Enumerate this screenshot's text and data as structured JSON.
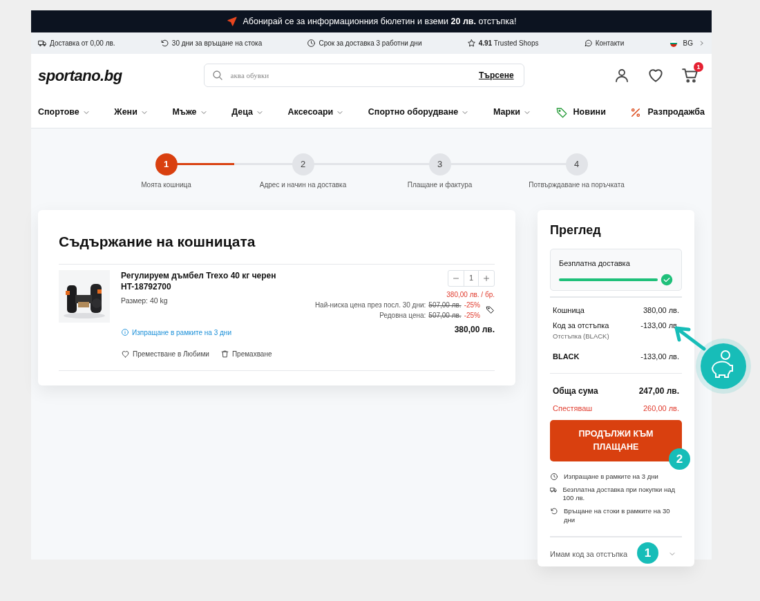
{
  "promo_bar": {
    "text": "Абонирай се за информационния бюлетин и вземи **20 лв.** отстъпка!"
  },
  "info_bar": [
    {
      "kind": "truck",
      "text": "Доставка от 0,00 лв."
    },
    {
      "kind": "return",
      "text": "30 дни за връщане на стока"
    },
    {
      "kind": "clock",
      "text": "Срок за доставка 3 работни дни"
    },
    {
      "kind": "star",
      "text": "**4.91** Trusted Shops"
    },
    {
      "kind": "chat",
      "text": "Контакти"
    },
    {
      "kind": "flag",
      "text": "BG"
    }
  ],
  "header": {
    "logo": "sportano.bg",
    "search": {
      "placeholder": "аква обувки",
      "button": "Търсене"
    },
    "cart_count": "1"
  },
  "nav": [
    {
      "label": "Спортове",
      "kind": "dropdown"
    },
    {
      "label": "Жени",
      "kind": "dropdown"
    },
    {
      "label": "Мъже",
      "kind": "dropdown"
    },
    {
      "label": "Деца",
      "kind": "dropdown"
    },
    {
      "label": "Аксесоари",
      "kind": "dropdown"
    },
    {
      "label": "Спортно оборудване",
      "kind": "dropdown"
    },
    {
      "label": "Марки",
      "kind": "dropdown"
    },
    {
      "label": "Новини",
      "kind": "tag"
    },
    {
      "label": "Разпродажба",
      "kind": "sale"
    }
  ],
  "steps": [
    {
      "number": "1",
      "label": "Моята кошница",
      "selected": true
    },
    {
      "number": "2",
      "label": "Адрес и начин на доставка",
      "selected": false
    },
    {
      "number": "3",
      "label": "Плащане и фактура",
      "selected": false
    },
    {
      "number": "4",
      "label": "Потвърждаване на поръчката",
      "selected": false
    }
  ],
  "step_progress": {
    "level": 0.165
  },
  "cart": {
    "title": "Съдържание на кошницата",
    "items": [
      {
        "name": "Регулируем дъмбел Trexo 40 кг черен HT-18792700",
        "size": "Размер: 40 kg",
        "quantity": "1",
        "unit_price": "380,00 лв. / бр.",
        "lowest_price_label": "Най-ниска цена през посл. 30 дни:",
        "lowest_price": "507,00 лв.",
        "lowest_discount": "-25%",
        "regular_label": "Редовна цена:",
        "regular_price": "507,00 лв.",
        "regular_discount": "-25%",
        "total": "380,00 лв.",
        "shipping_note": "Изпращане в рамките на 3 дни",
        "actions": [
          {
            "kind": "favorite",
            "label": "Преместване в Любими"
          },
          {
            "kind": "remove",
            "label": "Премахване"
          }
        ]
      }
    ]
  },
  "summary": {
    "title": "Преглед",
    "free_delivery": {
      "label": "Безплатна доставка",
      "level": 1
    },
    "lines": [
      {
        "kind": "line",
        "label": "Кошница",
        "value": "380,00 лв."
      },
      {
        "kind": "line",
        "label": "Код за отстъпка",
        "sublabel": "Отстъпка (BLACK)",
        "value": "-133,00 лв."
      },
      {
        "kind": "code",
        "label": "BLACK",
        "value": "-133,00 лв."
      }
    ],
    "total": {
      "label": "Обща сума",
      "value": "247,00 лв."
    },
    "savings": {
      "label": "Спестяваш",
      "value": "260,00 лв."
    },
    "checkout_button": {
      "label": "ПРОДЪЛЖИ КЪМ ПЛАЩАНЕ",
      "marker": "2"
    },
    "perks": [
      {
        "kind": "clock",
        "text": "Изпращане в рамките на 3 дни"
      },
      {
        "kind": "truck",
        "text": "Безплатна доставка при покупки над 100 лв."
      },
      {
        "kind": "return",
        "text": "Връщане на стоки в рамките на 30 дни"
      }
    ],
    "discount_toggle": {
      "label": "Имам код за отстъпка",
      "expanded": false,
      "marker": "1"
    }
  }
}
